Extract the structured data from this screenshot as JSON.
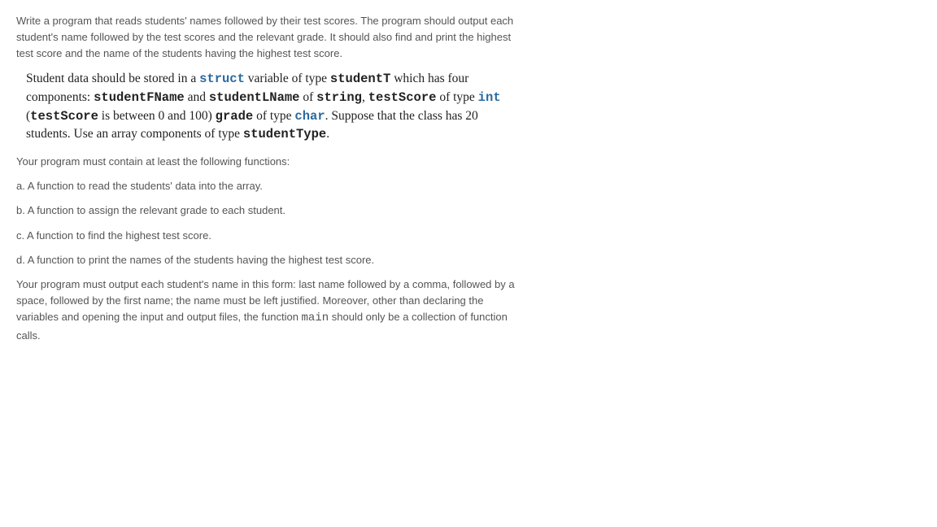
{
  "intro": "Write a program that reads students' names followed by their test scores. The program should output each student's name followed by the test scores and the relevant grade. It should also find and print the highest test score and the name of the students having the highest test score.",
  "instruction": {
    "l1_a": "Student data should be stored in a ",
    "kw_struct": "struct",
    "l1_b": " variable of type ",
    "studentT": "studentT",
    "l2_a": "which has four components: ",
    "studentFName": "studentFName",
    "l2_b": " and ",
    "studentLName": "studentLName",
    "l2_c": " of ",
    "string_kw": "string",
    "l3_a": ", ",
    "testScore": "testScore",
    "l3_b": " of type ",
    "int_kw": "int",
    "l3_c": " (",
    "testScore2": "testScore",
    "l3_d": " is between 0 and 100) ",
    "grade": "grade",
    "l4_a": " of type ",
    "char_kw": "char",
    "l4_b": ". Suppose that the class has 20 students. Use an array ",
    "l5_a": "components of type ",
    "studentType": "studentType",
    "l5_b": "."
  },
  "functions_heading": "Your program must contain at least the following functions:",
  "functions": [
    "a. A function to read the students' data into the array.",
    "b. A function to assign the relevant grade to each student.",
    "c. A function to find the highest test score.",
    "d. A function to print the names of the students having the highest test score."
  ],
  "closing_a": "Your program must output each student's name in this form: last name followed by a comma, followed by a space, followed by the first name; the name must be left justified. Moreover, other than declaring the variables and opening the input and output files, the function ",
  "main_label": "main",
  "closing_b": " should only be a collection of function calls."
}
